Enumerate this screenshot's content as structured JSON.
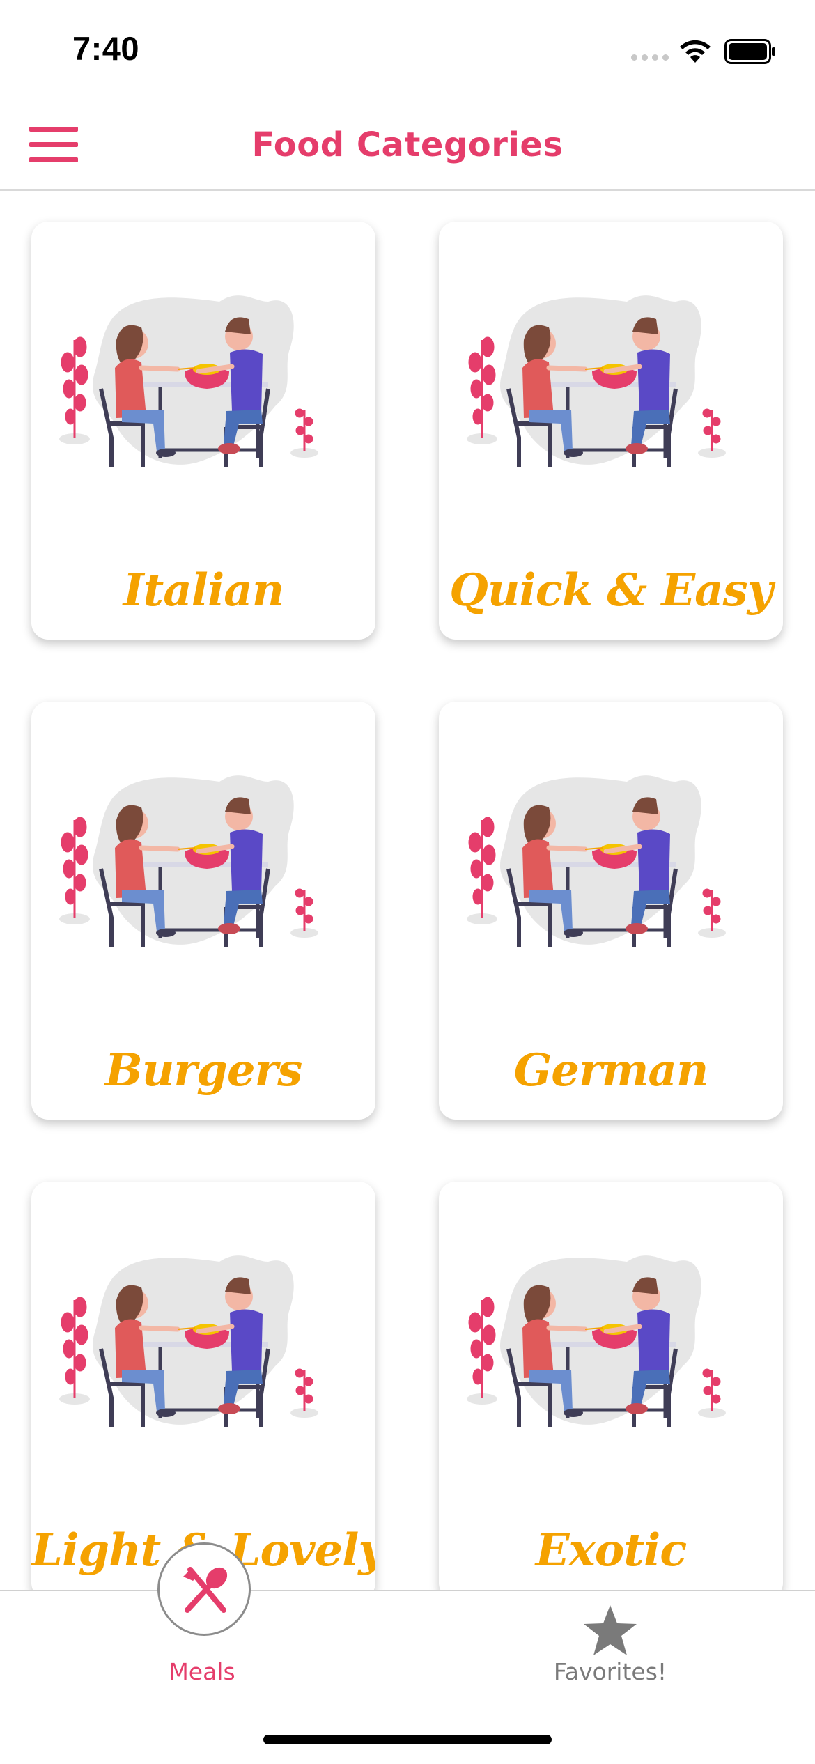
{
  "status_bar": {
    "time": "7:40",
    "signal_icon": "cellular-dots-icon",
    "wifi_icon": "wifi-icon",
    "battery_icon": "battery-icon"
  },
  "app_bar": {
    "title": "Food Categories",
    "menu_icon": "hamburger-menu-icon",
    "accent_color": "#e53d6b"
  },
  "categories": [
    {
      "label": "Italian"
    },
    {
      "label": "Quick & Easy"
    },
    {
      "label": "Burgers"
    },
    {
      "label": "German"
    },
    {
      "label": "Light & Lovely"
    },
    {
      "label": "Exotic"
    }
  ],
  "category_label_color": "#f5a200",
  "bottom_nav": {
    "items": [
      {
        "label": "Meals",
        "icon": "fork-spoon-icon",
        "active": true
      },
      {
        "label": "Favorites!",
        "icon": "star-icon",
        "active": false
      }
    ],
    "active_color": "#e53d6b",
    "inactive_color": "#7a7a7a"
  }
}
